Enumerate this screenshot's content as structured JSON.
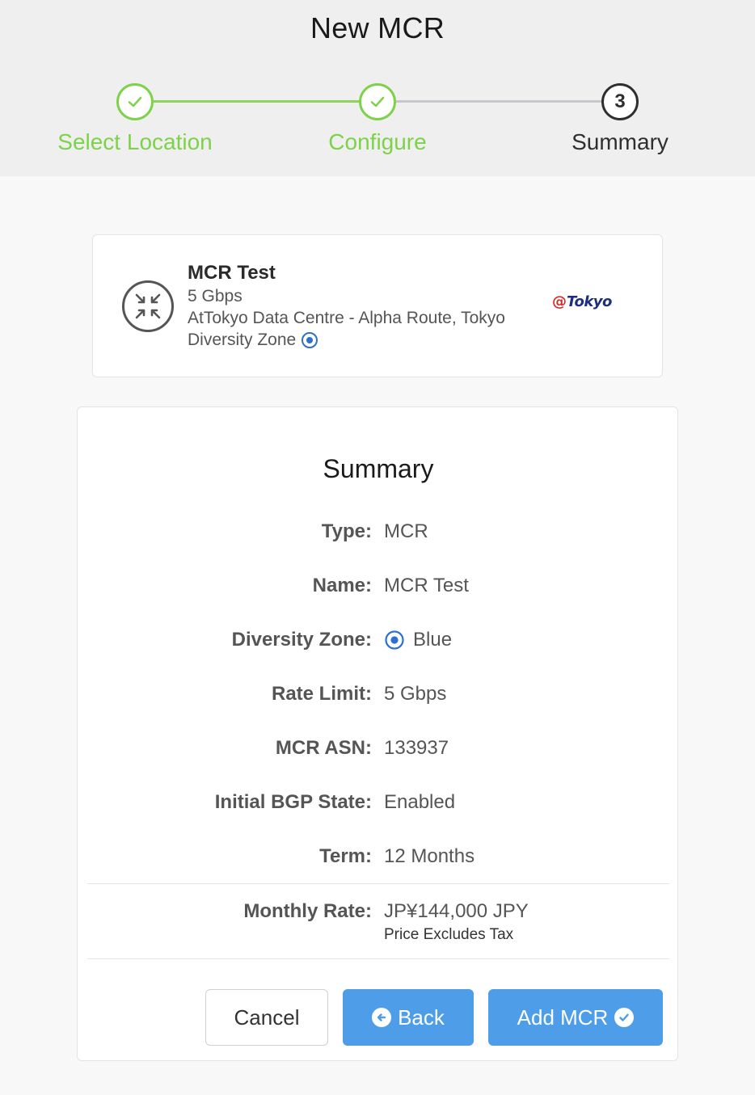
{
  "page": {
    "title": "New MCR"
  },
  "steps": [
    {
      "label": "Select Location",
      "status": "done"
    },
    {
      "label": "Configure",
      "status": "done"
    },
    {
      "number": "3",
      "label": "Summary",
      "status": "current"
    }
  ],
  "mcr_card": {
    "icon": "mcr-arrows-icon",
    "name": "MCR Test",
    "speed": "5 Gbps",
    "location": "AtTokyo Data Centre - Alpha Route, Tokyo",
    "diversity_zone_label": "Diversity Zone",
    "diversity_zone_icon": "blue-zone-icon",
    "logo_at": "@",
    "logo_text": "Tokyo"
  },
  "summary": {
    "title": "Summary",
    "rows": [
      {
        "label": "Type:",
        "value": "MCR"
      },
      {
        "label": "Name:",
        "value": "MCR Test"
      },
      {
        "label": "Diversity Zone:",
        "value": "Blue"
      },
      {
        "label": "Rate Limit:",
        "value": "5 Gbps"
      },
      {
        "label": "MCR ASN:",
        "value": "133937"
      },
      {
        "label": "Initial BGP State:",
        "value": "Enabled"
      },
      {
        "label": "Term:",
        "value": "12 Months"
      }
    ],
    "monthly_rate": {
      "label": "Monthly Rate:",
      "value": "JP¥144,000 JPY",
      "note": "Price Excludes Tax"
    }
  },
  "buttons": {
    "cancel": "Cancel",
    "back": "Back",
    "add": "Add MCR"
  },
  "colors": {
    "done": "#7ed24a",
    "primary": "#4d9de8",
    "zone_blue": "#2f6fd0"
  }
}
